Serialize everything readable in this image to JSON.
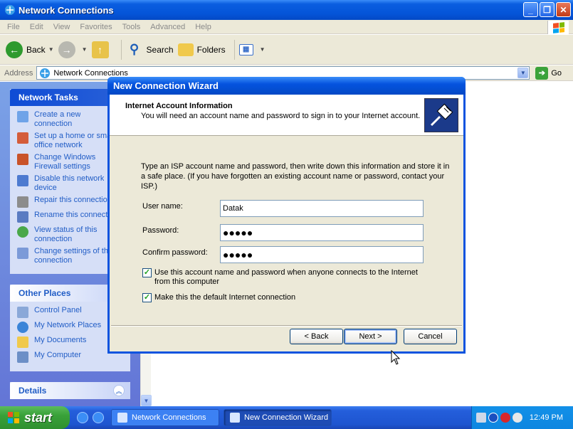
{
  "window": {
    "title": "Network Connections",
    "buttons": [
      "minimize",
      "maximize",
      "close"
    ]
  },
  "menu": [
    "File",
    "Edit",
    "View",
    "Favorites",
    "Tools",
    "Advanced",
    "Help"
  ],
  "toolbar": {
    "back": "Back",
    "search": "Search",
    "folders": "Folders"
  },
  "address": {
    "label": "Address",
    "value": "Network Connections",
    "go": "Go"
  },
  "sidebar": {
    "network_tasks": {
      "title": "Network Tasks",
      "items": [
        "Create a new\nconnection",
        "Set up a home or sma\noffice network",
        "Change Windows\nFirewall settings",
        "Disable this network\ndevice",
        "Repair this connectio",
        "Rename this connect",
        "View status of this\nconnection",
        "Change settings of th\nconnection"
      ]
    },
    "other_places": {
      "title": "Other Places",
      "items": [
        "Control Panel",
        "My Network Places",
        "My Documents",
        "My Computer"
      ]
    },
    "details": {
      "title": "Details"
    }
  },
  "dialog": {
    "title": "New Connection Wizard",
    "header_title": "Internet Account Information",
    "header_subtitle": "You will need an account name and password to sign in to your Internet account.",
    "instructions": "Type an ISP account name and password, then write down this information and store it in a safe place. (If you have forgotten an existing account name or password, contact your ISP.)",
    "username_label": "User name:",
    "username_value": "Datak",
    "password_label": "Password:",
    "password_value": "●●●●●",
    "confirm_label": "Confirm password:",
    "confirm_value": "●●●●●",
    "check1": "Use this account  name and password when anyone connects to the Internet from this computer",
    "check1_checked": true,
    "check2": "Make this the default Internet connection",
    "check2_checked": true,
    "back_button": "< Back",
    "next_button": "Next >",
    "cancel_button": "Cancel"
  },
  "taskbar": {
    "start": "start",
    "tasks": [
      "Network Connections",
      "New Connection Wizard"
    ],
    "clock": "12:49 PM"
  }
}
